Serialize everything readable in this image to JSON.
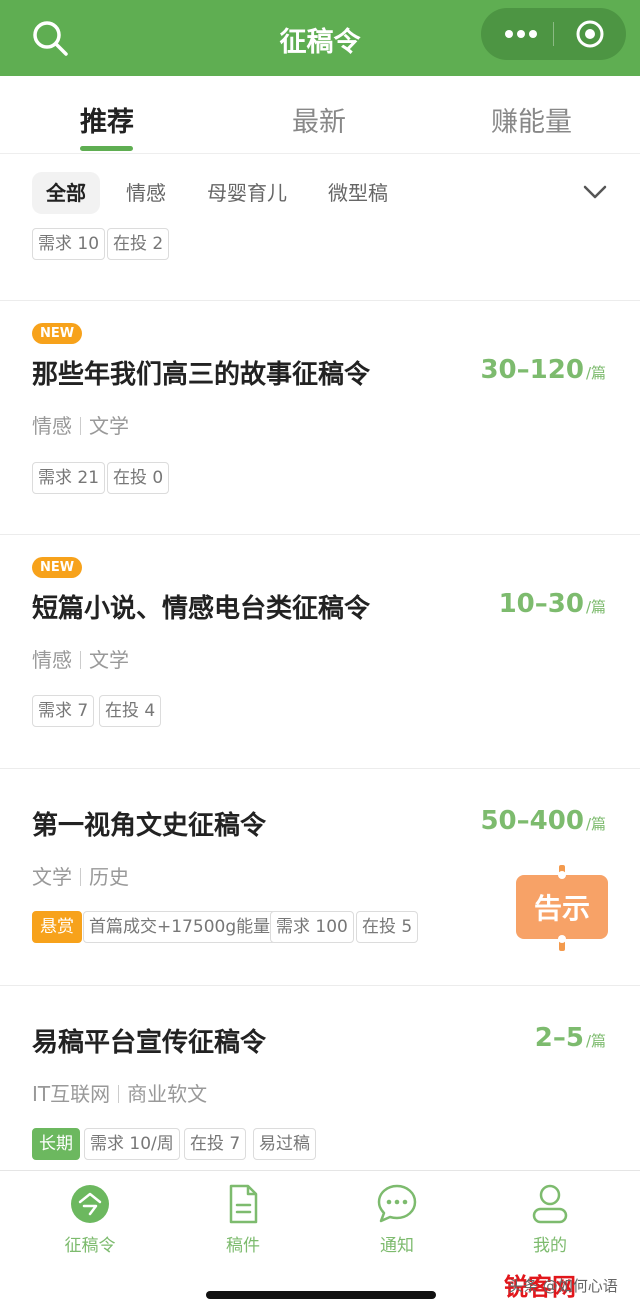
{
  "header": {
    "title": "征稿令",
    "search_icon": "search-icon",
    "menu_icon": "more-dots-icon",
    "close_icon": "target-circle-icon",
    "bg_color": "#5fae52"
  },
  "tabs": [
    {
      "label": "推荐",
      "active": true
    },
    {
      "label": "最新",
      "active": false
    },
    {
      "label": "赚能量",
      "active": false
    }
  ],
  "filters": {
    "chips": [
      "全部",
      "情感",
      "母婴育儿",
      "微型稿"
    ],
    "expand_icon": "chevron-down-icon"
  },
  "partial_card": {
    "tags": [
      "需求 10",
      "在投 2"
    ]
  },
  "cards": [
    {
      "new_badge": "NEW",
      "title": "那些年我们高三的故事征稿令",
      "price": "30–120",
      "unit": "/篇",
      "categories": [
        "情感",
        "文学"
      ],
      "tags": [
        "需求 21",
        "在投 0"
      ]
    },
    {
      "new_badge": "NEW",
      "title": "短篇小说、情感电台类征稿令",
      "price": "10–30",
      "unit": "/篇",
      "categories": [
        "情感",
        "文学"
      ],
      "tags": [
        "需求 7",
        "在投 4"
      ]
    },
    {
      "title": "第一视角文史征稿令",
      "price": "50–400",
      "unit": "/篇",
      "categories": [
        "文学",
        "历史"
      ],
      "reward_label": "悬赏",
      "reward_text": "首篇成交+17500g能量",
      "tags": [
        "需求 100",
        "在投 5"
      ],
      "notice_badge": "告示"
    },
    {
      "title": "易稿平台宣传征稿令",
      "price": "2–5",
      "unit": "/篇",
      "categories": [
        "IT互联网",
        "商业软文"
      ],
      "longterm_label": "长期",
      "tags": [
        "需求 10/周",
        "在投 7",
        "易过稿"
      ]
    }
  ],
  "bottom_nav": [
    {
      "label": "征稿令",
      "icon": "call-for-papers-icon"
    },
    {
      "label": "稿件",
      "icon": "document-icon"
    },
    {
      "label": "通知",
      "icon": "chat-bubble-icon"
    },
    {
      "label": "我的",
      "icon": "user-icon"
    }
  ],
  "watermark": {
    "prefix": "头条 @如何心语",
    "logo": "锐客网"
  }
}
